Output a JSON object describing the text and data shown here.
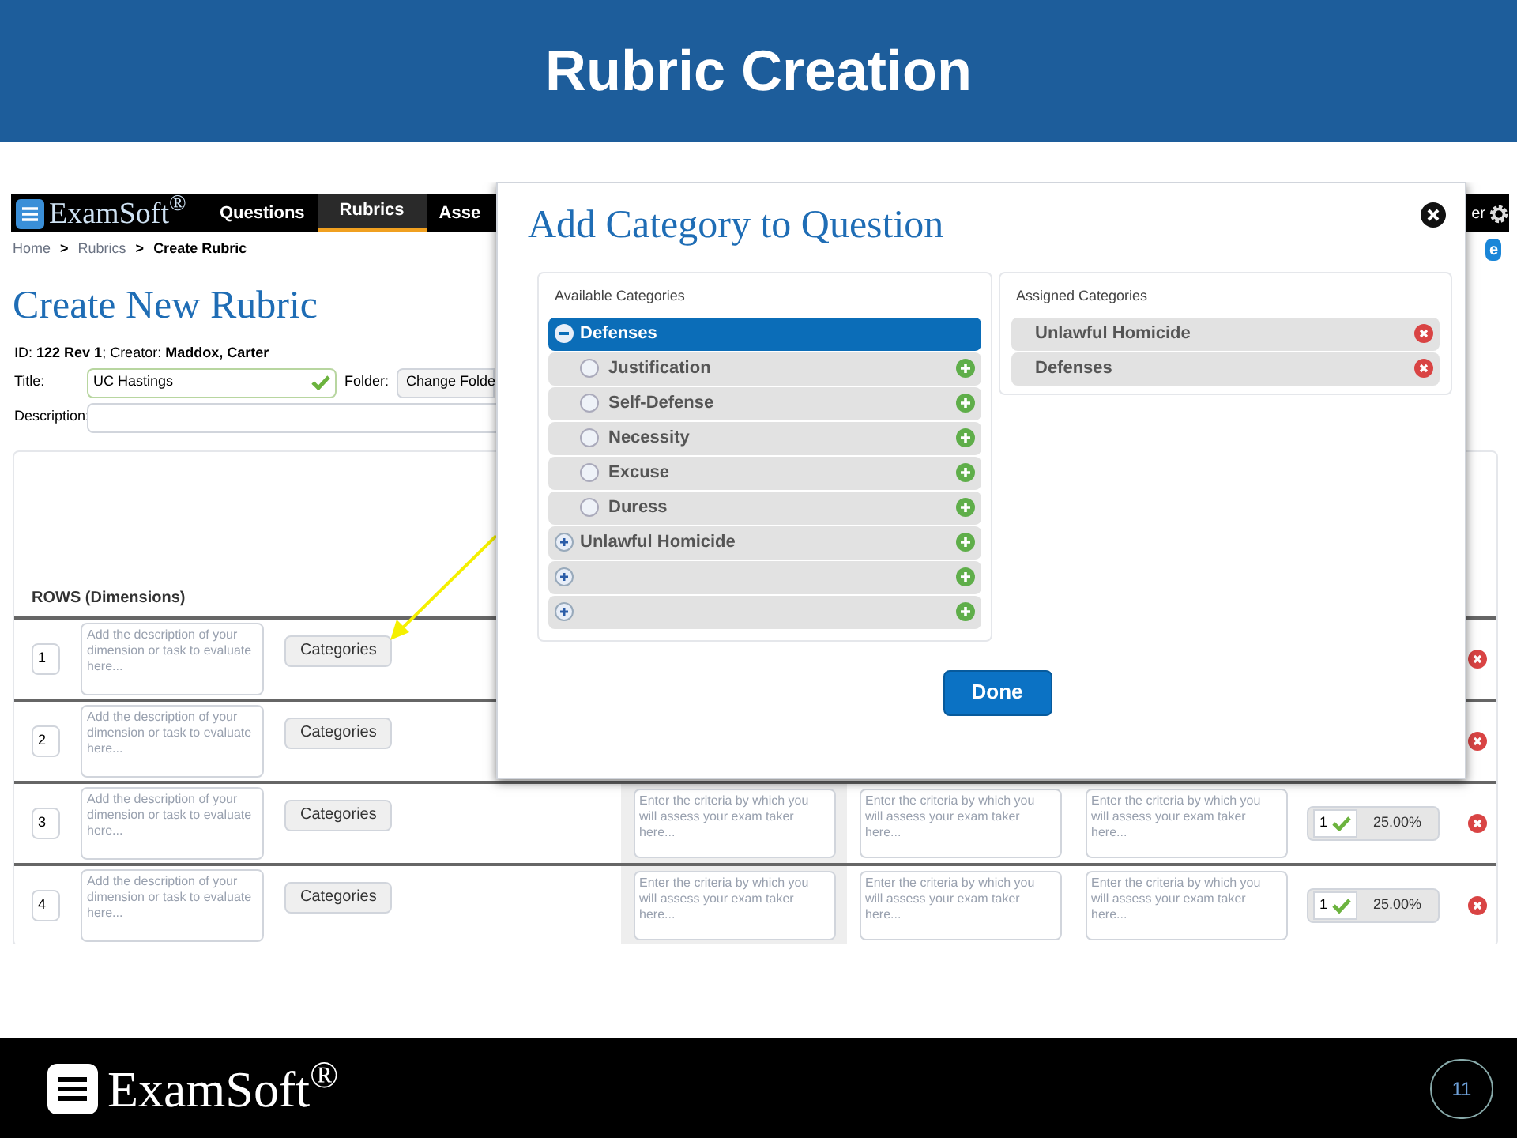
{
  "slide": {
    "title": "Rubric Creation",
    "footer_logo": "ExamSoft$^{®}$",
    "page_number": "11"
  },
  "app": {
    "logo": "ExamSoft$^{®}$",
    "tabs": [
      {
        "label": "Questions",
        "selected": false
      },
      {
        "label": "Rubrics",
        "selected": true
      },
      {
        "label": "Asse",
        "selected": false
      }
    ],
    "nav_right": "er",
    "corner_button": "e",
    "breadcrumb": [
      "Home",
      "Rubrics",
      "Create Rubric"
    ],
    "breadcrumb_separator": ">",
    "heading": "Create New Rubric",
    "id_line": "ID: **122 Rev 1**; Creator: **Maddox, Carter**",
    "title_label": "Title:",
    "title_value": "UC Hastings",
    "title_valid": true,
    "folder_label": "Folder:",
    "folder_button": "Change Folde",
    "description_label": "Description:",
    "rows_heading": "ROWS (Dimensions)",
    "rows": [
      {
        "number": "1",
        "placeholder": "Add the description of your dimension or task to evaluate here...",
        "button": "Categories"
      },
      {
        "number": "2",
        "placeholder": "Add the description of your dimension or task to evaluate here...",
        "button": "Categories"
      },
      {
        "number": "3",
        "placeholder": "Add the description of your dimension or task to evaluate here...",
        "button": "Categories",
        "criteria": [
          {
            "placeholder": "Enter the criteria by which you will assess your exam taker here..."
          },
          {
            "placeholder": "Enter the criteria by which you will assess your exam taker here..."
          },
          {
            "placeholder": "Enter the criteria by which you will assess your exam taker here..."
          }
        ],
        "weight": "1",
        "weight_valid": true,
        "percent": "25.00%"
      },
      {
        "number": "4",
        "placeholder": "Add the description of your dimension or task to evaluate here...",
        "button": "Categories",
        "criteria": [
          {
            "placeholder": "Enter the criteria by which you will assess your exam taker here..."
          },
          {
            "placeholder": "Enter the criteria by which you will assess your exam taker here..."
          },
          {
            "placeholder": "Enter the criteria by which you will assess your exam taker here..."
          }
        ],
        "weight": "1",
        "weight_valid": true,
        "percent": "25.00%"
      }
    ]
  },
  "dialog": {
    "title": "Add Category to Question",
    "available_label": "Available Categories",
    "available": [
      {
        "label": "Defenses",
        "expanded": true,
        "selected": true,
        "children": [
          {
            "label": "Justification",
            "selected": false
          },
          {
            "label": "Self-Defense",
            "selected": false
          },
          {
            "label": "Necessity",
            "selected": false
          },
          {
            "label": "Excuse",
            "selected": false
          },
          {
            "label": "Duress",
            "selected": false
          }
        ]
      },
      {
        "label": "Unlawful Homicide",
        "expanded": false,
        "selected": false
      },
      {
        "expanded": false,
        "selected": false
      },
      {
        "expanded": false,
        "selected": false
      }
    ],
    "assigned_label": "Assigned Categories",
    "assigned": [
      "Unlawful Homicide",
      "Defenses"
    ],
    "done_button": "Done"
  }
}
